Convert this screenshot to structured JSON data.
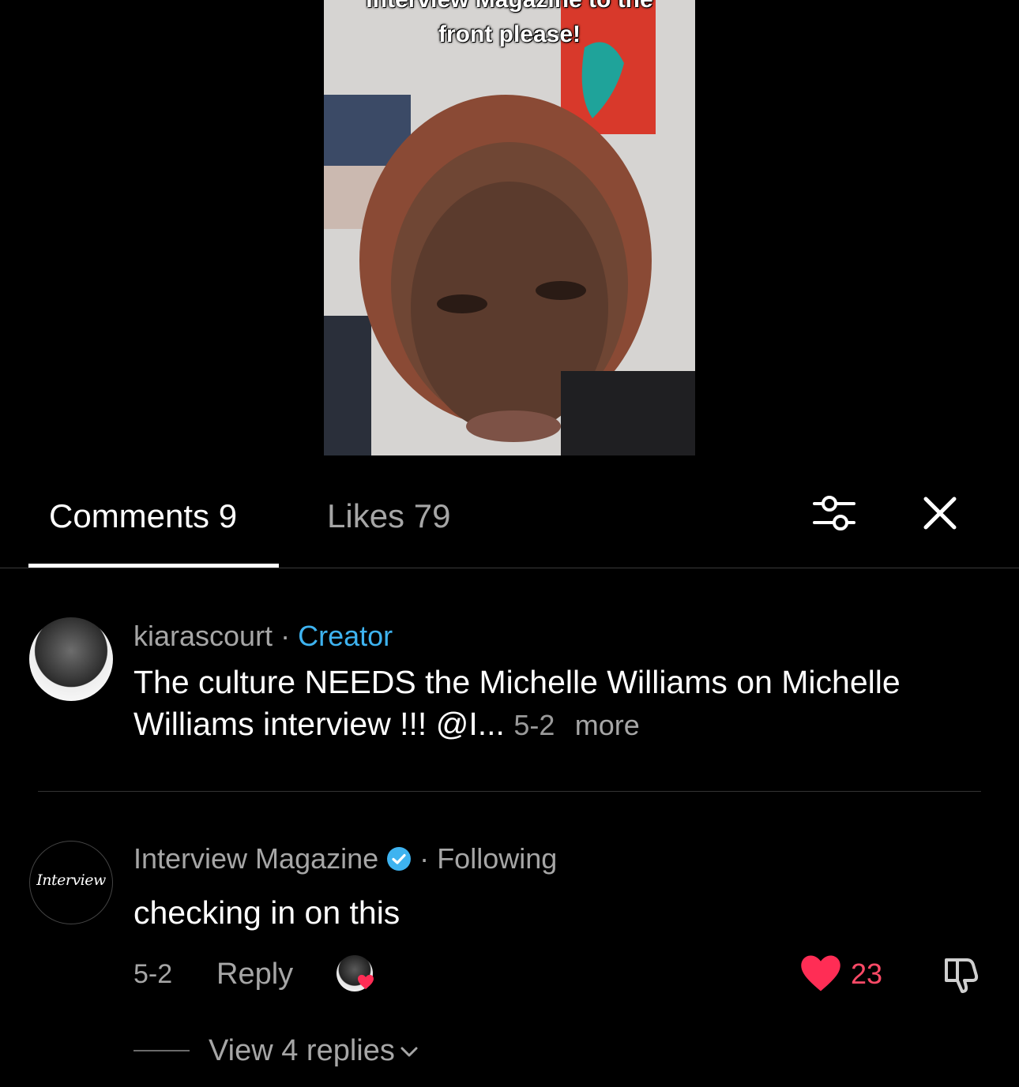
{
  "video": {
    "caption_line1": "Interview Magazine to the",
    "caption_line2": "front please!"
  },
  "tabs": {
    "comments_label": "Comments 9",
    "likes_label": "Likes 79"
  },
  "comments": [
    {
      "username": "kiarascourt",
      "separator": "·",
      "badge": "Creator",
      "text": "The culture NEEDS the Michelle Williams on Michelle Williams interview !!! @I...",
      "date": "5-2",
      "more_label": "more"
    },
    {
      "username": "Interview Magazine",
      "separator": "·",
      "relation": "Following",
      "avatar_logo": "Interview",
      "text": "checking in on this",
      "date": "5-2",
      "reply_label": "Reply",
      "like_count": "23",
      "view_replies_label": "View 4 replies"
    }
  ],
  "colors": {
    "background": "#000000",
    "creator_badge": "#3eb3f0",
    "like_heart": "#ff2d55",
    "like_count": "#ff4a67",
    "muted_text": "#a6a6a6"
  },
  "icons": [
    "filter-icon",
    "close-icon",
    "verified-icon",
    "heart-icon",
    "dislike-icon",
    "chevron-down-icon"
  ]
}
